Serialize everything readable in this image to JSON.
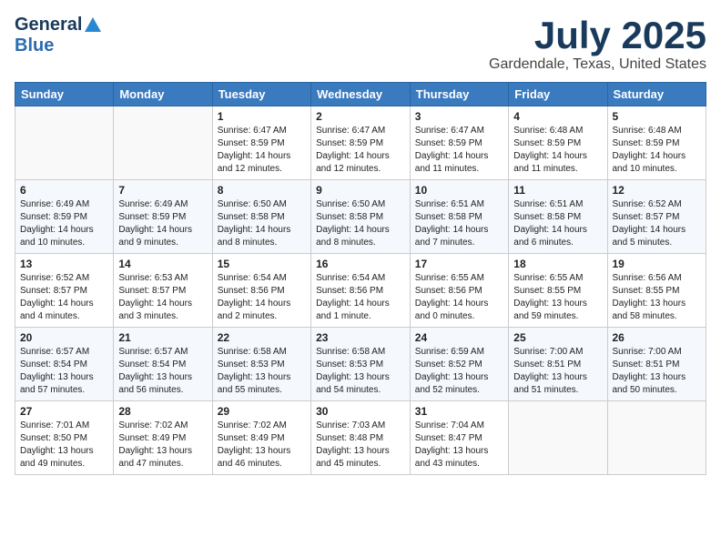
{
  "header": {
    "logo_general": "General",
    "logo_blue": "Blue",
    "month_title": "July 2025",
    "location": "Gardendale, Texas, United States"
  },
  "weekdays": [
    "Sunday",
    "Monday",
    "Tuesday",
    "Wednesday",
    "Thursday",
    "Friday",
    "Saturday"
  ],
  "weeks": [
    [
      {
        "day": "",
        "info": ""
      },
      {
        "day": "",
        "info": ""
      },
      {
        "day": "1",
        "info": "Sunrise: 6:47 AM\nSunset: 8:59 PM\nDaylight: 14 hours and 12 minutes."
      },
      {
        "day": "2",
        "info": "Sunrise: 6:47 AM\nSunset: 8:59 PM\nDaylight: 14 hours and 12 minutes."
      },
      {
        "day": "3",
        "info": "Sunrise: 6:47 AM\nSunset: 8:59 PM\nDaylight: 14 hours and 11 minutes."
      },
      {
        "day": "4",
        "info": "Sunrise: 6:48 AM\nSunset: 8:59 PM\nDaylight: 14 hours and 11 minutes."
      },
      {
        "day": "5",
        "info": "Sunrise: 6:48 AM\nSunset: 8:59 PM\nDaylight: 14 hours and 10 minutes."
      }
    ],
    [
      {
        "day": "6",
        "info": "Sunrise: 6:49 AM\nSunset: 8:59 PM\nDaylight: 14 hours and 10 minutes."
      },
      {
        "day": "7",
        "info": "Sunrise: 6:49 AM\nSunset: 8:59 PM\nDaylight: 14 hours and 9 minutes."
      },
      {
        "day": "8",
        "info": "Sunrise: 6:50 AM\nSunset: 8:58 PM\nDaylight: 14 hours and 8 minutes."
      },
      {
        "day": "9",
        "info": "Sunrise: 6:50 AM\nSunset: 8:58 PM\nDaylight: 14 hours and 8 minutes."
      },
      {
        "day": "10",
        "info": "Sunrise: 6:51 AM\nSunset: 8:58 PM\nDaylight: 14 hours and 7 minutes."
      },
      {
        "day": "11",
        "info": "Sunrise: 6:51 AM\nSunset: 8:58 PM\nDaylight: 14 hours and 6 minutes."
      },
      {
        "day": "12",
        "info": "Sunrise: 6:52 AM\nSunset: 8:57 PM\nDaylight: 14 hours and 5 minutes."
      }
    ],
    [
      {
        "day": "13",
        "info": "Sunrise: 6:52 AM\nSunset: 8:57 PM\nDaylight: 14 hours and 4 minutes."
      },
      {
        "day": "14",
        "info": "Sunrise: 6:53 AM\nSunset: 8:57 PM\nDaylight: 14 hours and 3 minutes."
      },
      {
        "day": "15",
        "info": "Sunrise: 6:54 AM\nSunset: 8:56 PM\nDaylight: 14 hours and 2 minutes."
      },
      {
        "day": "16",
        "info": "Sunrise: 6:54 AM\nSunset: 8:56 PM\nDaylight: 14 hours and 1 minute."
      },
      {
        "day": "17",
        "info": "Sunrise: 6:55 AM\nSunset: 8:56 PM\nDaylight: 14 hours and 0 minutes."
      },
      {
        "day": "18",
        "info": "Sunrise: 6:55 AM\nSunset: 8:55 PM\nDaylight: 13 hours and 59 minutes."
      },
      {
        "day": "19",
        "info": "Sunrise: 6:56 AM\nSunset: 8:55 PM\nDaylight: 13 hours and 58 minutes."
      }
    ],
    [
      {
        "day": "20",
        "info": "Sunrise: 6:57 AM\nSunset: 8:54 PM\nDaylight: 13 hours and 57 minutes."
      },
      {
        "day": "21",
        "info": "Sunrise: 6:57 AM\nSunset: 8:54 PM\nDaylight: 13 hours and 56 minutes."
      },
      {
        "day": "22",
        "info": "Sunrise: 6:58 AM\nSunset: 8:53 PM\nDaylight: 13 hours and 55 minutes."
      },
      {
        "day": "23",
        "info": "Sunrise: 6:58 AM\nSunset: 8:53 PM\nDaylight: 13 hours and 54 minutes."
      },
      {
        "day": "24",
        "info": "Sunrise: 6:59 AM\nSunset: 8:52 PM\nDaylight: 13 hours and 52 minutes."
      },
      {
        "day": "25",
        "info": "Sunrise: 7:00 AM\nSunset: 8:51 PM\nDaylight: 13 hours and 51 minutes."
      },
      {
        "day": "26",
        "info": "Sunrise: 7:00 AM\nSunset: 8:51 PM\nDaylight: 13 hours and 50 minutes."
      }
    ],
    [
      {
        "day": "27",
        "info": "Sunrise: 7:01 AM\nSunset: 8:50 PM\nDaylight: 13 hours and 49 minutes."
      },
      {
        "day": "28",
        "info": "Sunrise: 7:02 AM\nSunset: 8:49 PM\nDaylight: 13 hours and 47 minutes."
      },
      {
        "day": "29",
        "info": "Sunrise: 7:02 AM\nSunset: 8:49 PM\nDaylight: 13 hours and 46 minutes."
      },
      {
        "day": "30",
        "info": "Sunrise: 7:03 AM\nSunset: 8:48 PM\nDaylight: 13 hours and 45 minutes."
      },
      {
        "day": "31",
        "info": "Sunrise: 7:04 AM\nSunset: 8:47 PM\nDaylight: 13 hours and 43 minutes."
      },
      {
        "day": "",
        "info": ""
      },
      {
        "day": "",
        "info": ""
      }
    ]
  ]
}
